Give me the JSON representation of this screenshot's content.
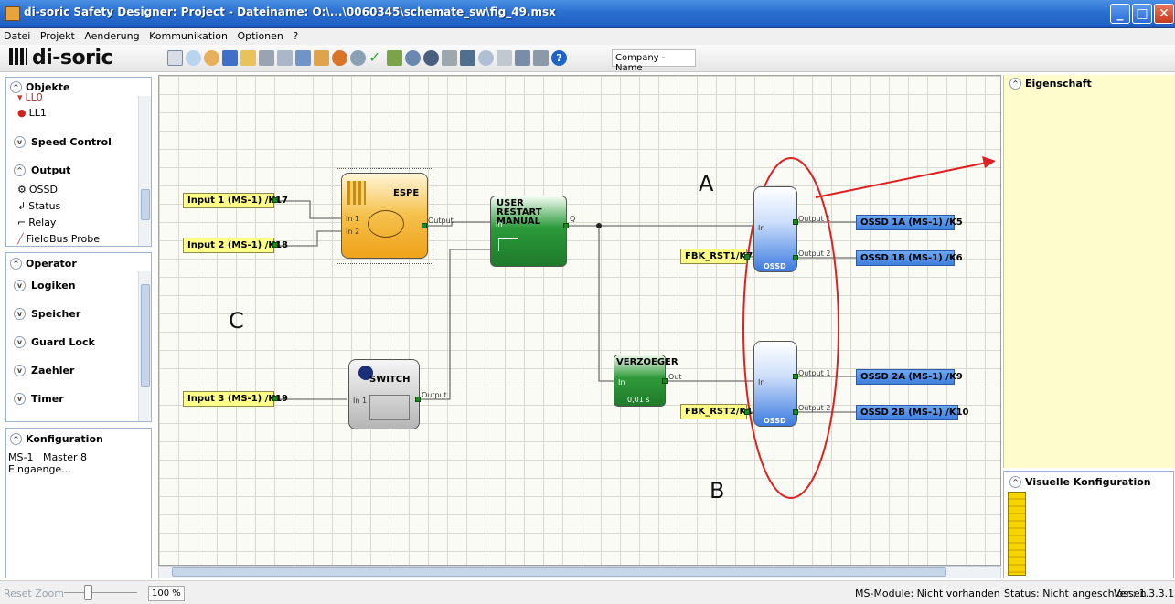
{
  "window": {
    "title": "di-soric Safety Designer: Project  -  Dateiname: O:\\...\\0060345\\schemate_sw\\fig_49.msx"
  },
  "menu": [
    "Datei",
    "Projekt",
    "Aenderung",
    "Kommunikation",
    "Optionen",
    "?"
  ],
  "toolbar": {
    "logo": "di-soric",
    "company_field": "Company - Name"
  },
  "objects_panel": {
    "title": "Objekte",
    "items_top": [
      "LL0",
      "LL1"
    ],
    "sections": [
      "Speed Control",
      "Output"
    ],
    "output_items": [
      "OSSD",
      "Status",
      "Relay",
      "FieldBus Probe"
    ]
  },
  "operator_panel": {
    "title": "Operator",
    "sections": [
      "Logiken",
      "Speicher",
      "Guard Lock",
      "Zaehler",
      "Timer"
    ]
  },
  "config_panel": {
    "title": "Konfiguration",
    "module_id": "MS-1",
    "module_name": "Master 8 Eingaenge..."
  },
  "diagram": {
    "inputs": [
      "Input 1 (MS-1) /K17",
      "Input 2 (MS-1) /K18",
      "Input 3 (MS-1) /K19"
    ],
    "feedbacks": [
      "FBK_RST1/K7",
      "FBK_RST2/K11"
    ],
    "outputs": [
      "OSSD 1A (MS-1)  /K5",
      "OSSD 1B (MS-1)  /K6",
      "OSSD 2A (MS-1)  /K9",
      "OSSD 2B (MS-1)  /K10"
    ],
    "blocks": {
      "espe": {
        "title": "ESPE",
        "in1": "In 1",
        "in2": "In 2",
        "out": "Output"
      },
      "restart": {
        "title": "USER RESTART MANUAL",
        "in": "In",
        "out": "Q"
      },
      "switch": {
        "title": "SWITCH",
        "in": "In 1",
        "out": "Output"
      },
      "delay": {
        "title": "VERZOEGER",
        "in": "In",
        "out": "Out",
        "value": "0,01 s"
      },
      "ossd": {
        "label": "OSSD",
        "in": "In",
        "out1": "Output 1",
        "out2": "Output 2"
      }
    },
    "annotations": {
      "a": "A",
      "b": "B",
      "c": "C"
    },
    "highlight_color": "#e02020"
  },
  "properties_panel": {
    "title": "Eigenschaft"
  },
  "visual_panel": {
    "title": "Visuelle Konfiguration"
  },
  "statusbar": {
    "reset_zoom": "Reset Zoom",
    "zoom": "100 %",
    "module_status": "MS-Module: Nicht vorhanden",
    "connection_status": "Status: Nicht angeschlossen",
    "version": "Ver.: 1.3.3.1"
  }
}
